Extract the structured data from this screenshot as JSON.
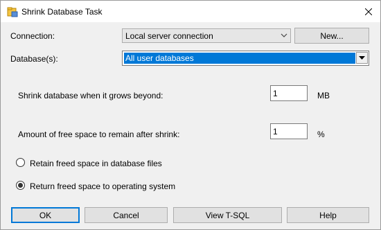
{
  "window": {
    "title": "Shrink Database Task",
    "close_glyph": "✕"
  },
  "connection": {
    "label": "Connection:",
    "value": "Local server connection",
    "new_button": "New..."
  },
  "databases": {
    "label": "Database(s):",
    "value": "All user databases"
  },
  "shrink": {
    "label": "Shrink database when it grows beyond:",
    "value": "1",
    "unit": "MB"
  },
  "free_space": {
    "label": "Amount of free space to remain after shrink:",
    "value": "1",
    "unit": "%"
  },
  "options": {
    "retain": {
      "label": "Retain freed space in database files",
      "selected": false
    },
    "return": {
      "label": "Return freed space to operating system",
      "selected": true
    }
  },
  "buttons": {
    "ok": "OK",
    "cancel": "Cancel",
    "view_tsql": "View T-SQL",
    "help": "Help"
  },
  "icons": {
    "title": "task-icon",
    "dropdown": "chevron-down-icon",
    "close": "close-icon"
  }
}
